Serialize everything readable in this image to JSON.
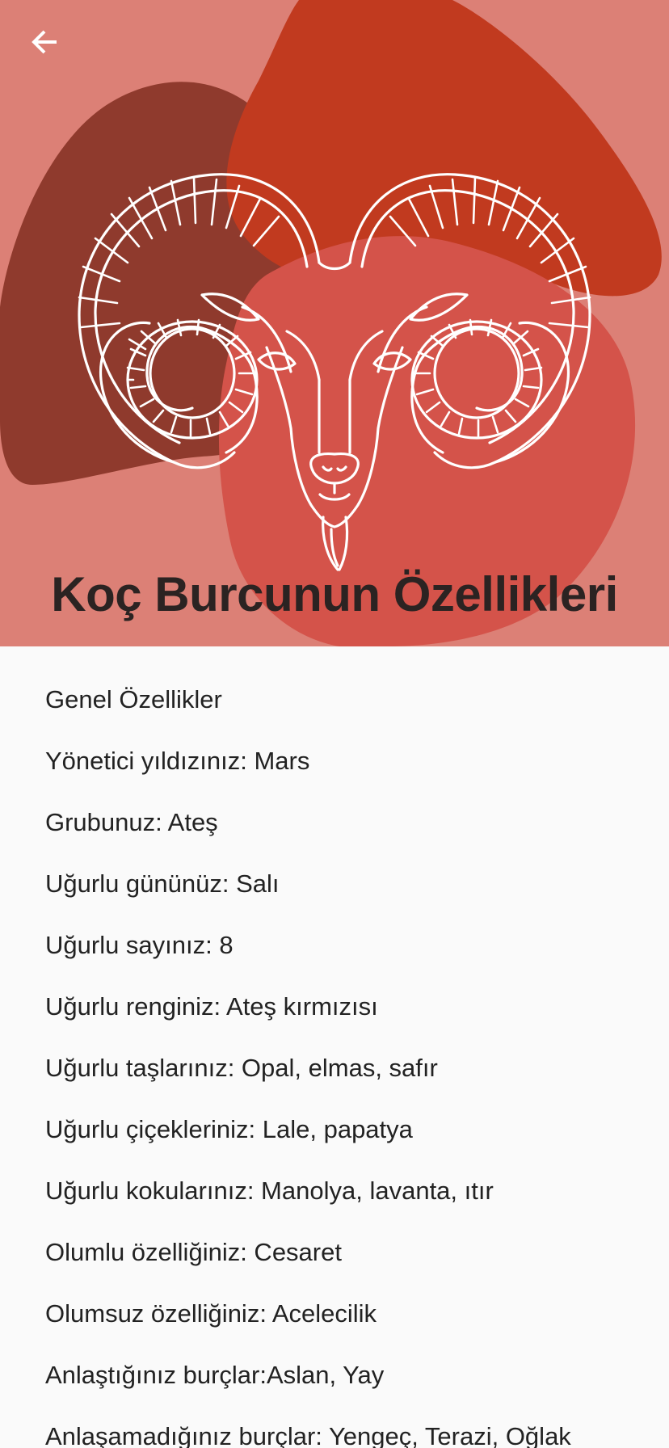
{
  "app_bar": {
    "back_icon": "arrow-left-icon"
  },
  "header": {
    "title": "Koç Burcunun Özellikleri",
    "colors": {
      "background": "#dc8076",
      "dark_blob": "#8f3a2d",
      "red_blob": "#c13a1f",
      "mid_blob": "#d4534a",
      "illustration_stroke": "#ffffff",
      "title_text": "#2b2322"
    },
    "illustration": "ram-head-icon"
  },
  "traits": [
    "Genel Özellikler",
    "Yönetici yıldızınız: Mars",
    "Grubunuz: Ateş",
    "Uğurlu gününüz: Salı",
    "Uğurlu sayınız: 8",
    "Uğurlu renginiz: Ateş kırmızısı",
    "Uğurlu taşlarınız: Opal, elmas, safır",
    "Uğurlu çiçekleriniz: Lale, papatya",
    "Uğurlu kokularınız: Manolya, lavanta, ıtır",
    "Olumlu özelliğiniz: Cesaret",
    "Olumsuz özelliğiniz: Acelecilik",
    "Anlaştığınız burçlar:Aslan, Yay",
    "Anlaşamadığınız burçlar: Yengeç, Terazi, Oğlak"
  ]
}
